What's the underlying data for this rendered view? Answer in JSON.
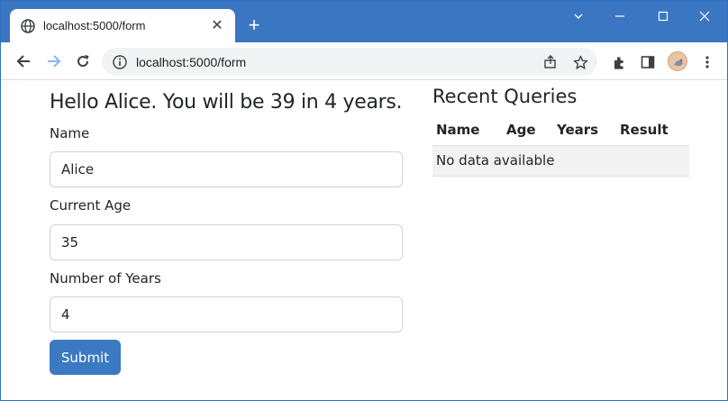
{
  "browser": {
    "tab_title": "localhost:5000/form",
    "new_tab_symbol": "+",
    "close_symbol": "✕",
    "url": "localhost:5000/form",
    "window_controls": {
      "minimize": "—",
      "maximize": "☐",
      "close": "✕",
      "chevron": "⌄"
    }
  },
  "page": {
    "headline": "Hello Alice. You will be 39 in 4 years.",
    "form": {
      "name_label": "Name",
      "name_value": "Alice",
      "age_label": "Current Age",
      "age_value": "35",
      "years_label": "Number of Years",
      "years_value": "4",
      "submit_label": "Submit"
    },
    "recent": {
      "title": "Recent Queries",
      "columns": [
        "Name",
        "Age",
        "Years",
        "Result"
      ],
      "empty_message": "No data available"
    }
  },
  "colors": {
    "titlebar": "#3a76c2",
    "submit_button": "#3b79c3",
    "empty_row_bg": "#f2f2f2"
  },
  "icons": [
    "globe-icon",
    "back-icon",
    "forward-icon",
    "reload-icon",
    "site-info-icon",
    "share-icon",
    "bookmark-star-icon",
    "extensions-icon",
    "side-panel-icon",
    "profile-avatar",
    "menu-icon"
  ]
}
